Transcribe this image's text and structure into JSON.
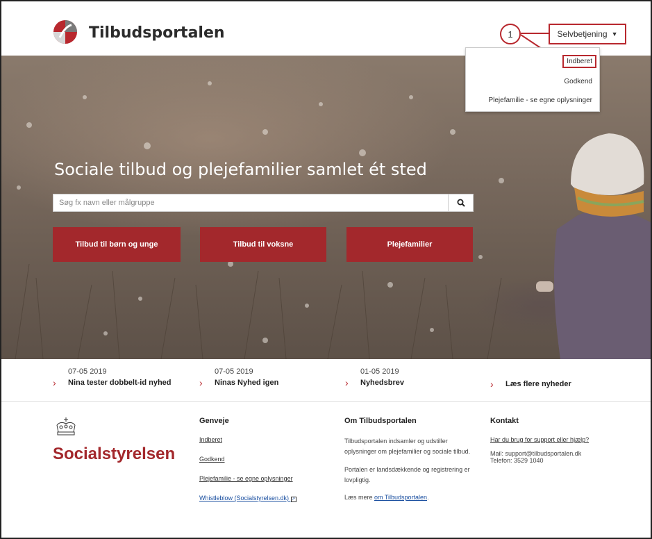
{
  "header": {
    "title": "Tilbudsportalen",
    "self_service_label": "Selvbetjening",
    "callout_number": "1"
  },
  "dropdown": {
    "items": [
      "Indberet",
      "Godkend",
      "Plejefamilie - se egne oplysninger"
    ]
  },
  "hero": {
    "title": "Sociale tilbud og plejefamilier samlet ét sted",
    "search_placeholder": "Søg fx navn eller målgruppe",
    "buttons": [
      "Tilbud til børn og unge",
      "Tilbud til voksne",
      "Plejefamilier"
    ]
  },
  "news": {
    "items": [
      {
        "date": "07-05 2019",
        "title": "Nina tester dobbelt-id nyhed"
      },
      {
        "date": "07-05 2019",
        "title": "Ninas Nyhed igen"
      },
      {
        "date": "01-05 2019",
        "title": "Nyhedsbrev"
      },
      {
        "date": "",
        "title": "Læs flere nyheder"
      }
    ]
  },
  "footer": {
    "brand": "Socialstyrelsen",
    "genveje": {
      "heading": "Genveje",
      "links": [
        "Indberet",
        "Godkend",
        "Plejefamilie - se egne oplysninger",
        "Whistleblow (Socialstyrelsen.dk)"
      ]
    },
    "om": {
      "heading": "Om Tilbudsportalen",
      "p1": "Tilbudsportalen indsamler og udstiller oplysninger om plejefamilier og sociale tilbud.",
      "p2": "Portalen er landsdækkende og registrering er lovpligtig.",
      "p3_prefix": "Læs mere ",
      "p3_link": "om Tilbudsportalen",
      "p3_suffix": "."
    },
    "kontakt": {
      "heading": "Kontakt",
      "link": "Har du brug for support eller hjælp?",
      "mail": "Mail: support@tilbudsportalen.dk",
      "phone": "Telefon: 3529 1040"
    }
  },
  "colors": {
    "accent": "#a3282c",
    "callout": "#b8282e",
    "link": "#1a4fa0"
  }
}
